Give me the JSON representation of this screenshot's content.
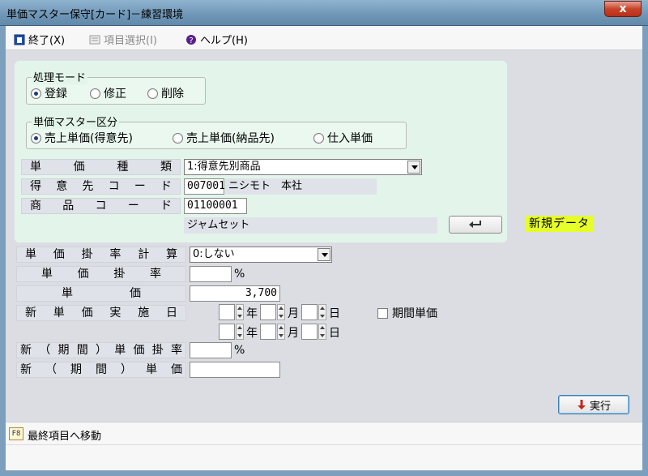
{
  "window": {
    "title": "単価マスター保守[カード]－練習環境",
    "close_label": "x"
  },
  "menu": {
    "exit": "終了(X)",
    "select_item": "項目選択(I)",
    "help": "ヘルプ(H)"
  },
  "mode_group": {
    "legend": "処理モード",
    "options": [
      {
        "label": "登録",
        "selected": true
      },
      {
        "label": "修正",
        "selected": false
      },
      {
        "label": "削除",
        "selected": false
      }
    ]
  },
  "category_group": {
    "legend": "単価マスター区分",
    "options": [
      {
        "label": "売上単価(得意先)",
        "selected": true
      },
      {
        "label": "売上単価(納品先)",
        "selected": false
      },
      {
        "label": "仕入単価",
        "selected": false
      }
    ]
  },
  "fields": {
    "price_type_label": [
      "単",
      "価",
      "種",
      "類"
    ],
    "price_type_value": "1:得意先別商品",
    "customer_code_label": [
      "得",
      "意",
      "先",
      "コ",
      "ー",
      "ド"
    ],
    "customer_code_value": "007001",
    "customer_name": "ニシモト　本社",
    "product_code_label": [
      "商",
      "品",
      "コ",
      "ー",
      "ド"
    ],
    "product_code_value": "01100001",
    "product_name": "ジャムセット",
    "enter_icon": "enter-icon",
    "new_badge": "新規データ"
  },
  "pricing": {
    "rate_calc_label": [
      "単",
      "価",
      "掛",
      "率",
      "計",
      "算"
    ],
    "rate_calc_value": "0:しない",
    "rate_label": [
      "単",
      "価",
      "掛",
      "率"
    ],
    "rate_value": "",
    "rate_unit": "%",
    "price_label": [
      "単",
      "価"
    ],
    "price_value": "3,700",
    "new_price_date_label": [
      "新",
      "単",
      "価",
      "実",
      "施",
      "日"
    ],
    "year_unit": "年",
    "month_unit": "月",
    "day_unit": "日",
    "period_checkbox": "期間単価",
    "period_rate_label": [
      "新",
      "（",
      "期",
      "間",
      "）",
      "単",
      "価",
      "掛",
      "率"
    ],
    "period_rate_value": "",
    "period_rate_unit": "%",
    "period_price_label": [
      "新",
      "（",
      "期",
      "間",
      "）",
      "単",
      "価"
    ],
    "period_price_value": ""
  },
  "actions": {
    "execute": "実行"
  },
  "status": {
    "fkey": "F8",
    "message": "最終項目へ移動"
  },
  "colors": {
    "title_bar": "#7c9fbd",
    "panel_bg": "#e3f5ea",
    "new_badge": "#e6ff2a",
    "close_button": "#c8432a"
  }
}
